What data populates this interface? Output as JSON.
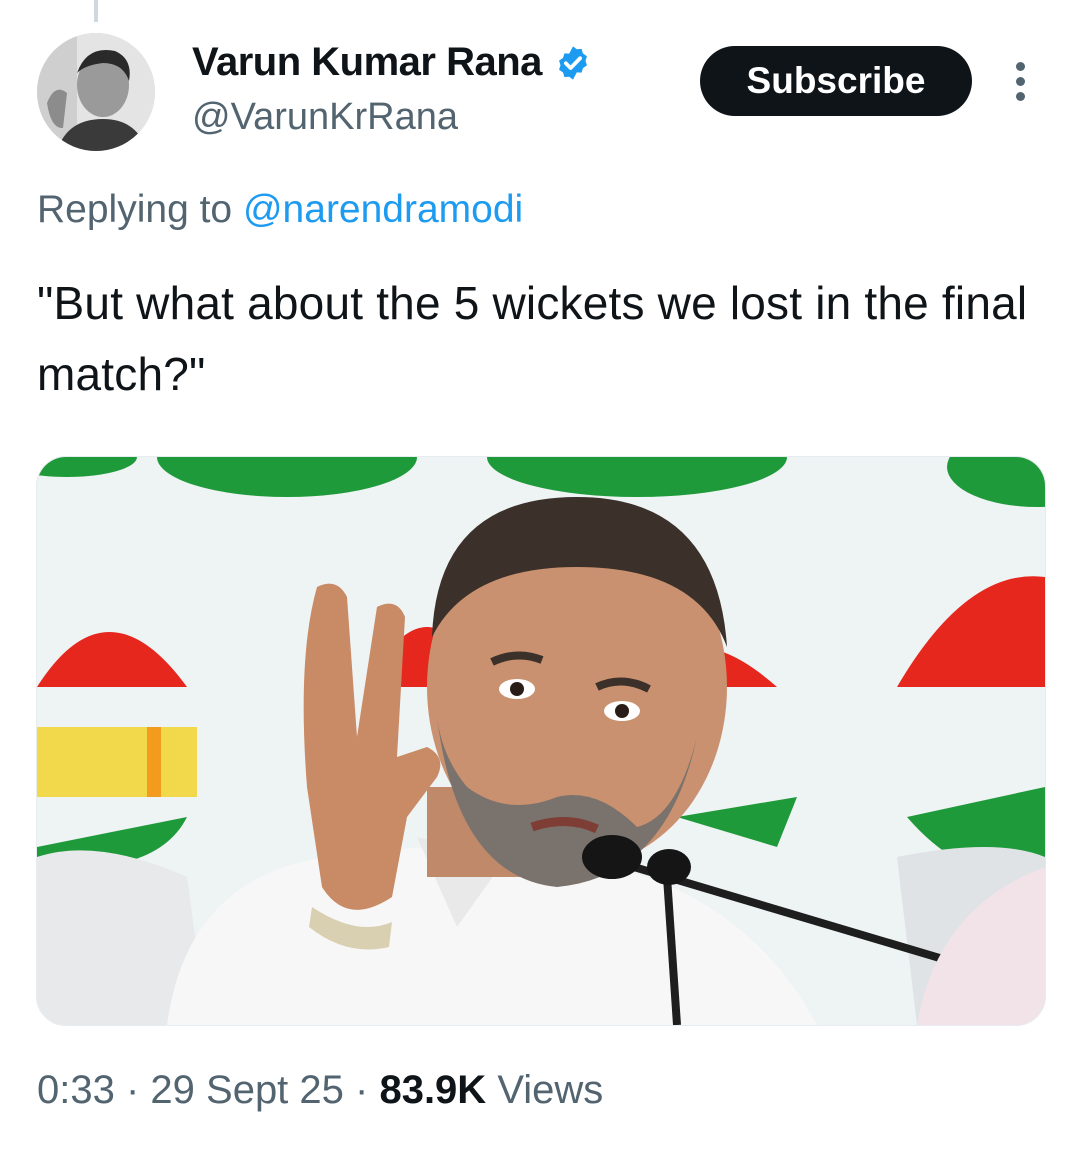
{
  "author": {
    "display_name": "Varun Kumar Rana",
    "handle": "@VarunKrRana",
    "verified_icon": "verified-badge-icon",
    "accent_color": "#1d9bf0"
  },
  "actions": {
    "subscribe_label": "Subscribe",
    "more_icon": "more-vertical-icon"
  },
  "reply": {
    "prefix": "Replying to",
    "mention": "@narendramodi"
  },
  "tweet": {
    "text": "\"But what about the 5 wickets we lost in the final match?\""
  },
  "meta": {
    "time": "0:33",
    "sep1": " · ",
    "date": "29 Sept 25",
    "sep2": " · ",
    "views_count": "83.9K",
    "views_label": " Views"
  }
}
